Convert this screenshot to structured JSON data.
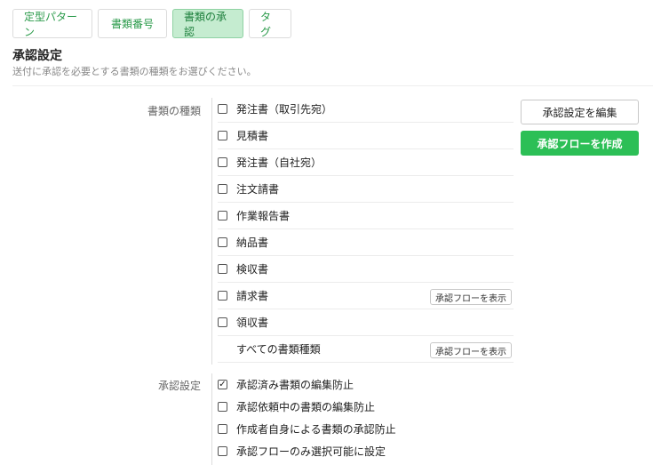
{
  "tabs": [
    {
      "label": "定型パターン",
      "active": false
    },
    {
      "label": "書類番号",
      "active": false
    },
    {
      "label": "書類の承認",
      "active": true
    },
    {
      "label": "タグ",
      "active": false
    }
  ],
  "section": {
    "title": "承認設定",
    "description": "送付に承認を必要とする書類の種類をお選びください。"
  },
  "doc_types": {
    "label": "書類の種類",
    "items": [
      {
        "label": "発注書（取引先宛）",
        "checked": false,
        "has_checkbox": true,
        "flow_button": ""
      },
      {
        "label": "見積書",
        "checked": false,
        "has_checkbox": true,
        "flow_button": ""
      },
      {
        "label": "発注書（自社宛）",
        "checked": false,
        "has_checkbox": true,
        "flow_button": ""
      },
      {
        "label": "注文請書",
        "checked": false,
        "has_checkbox": true,
        "flow_button": ""
      },
      {
        "label": "作業報告書",
        "checked": false,
        "has_checkbox": true,
        "flow_button": ""
      },
      {
        "label": "納品書",
        "checked": false,
        "has_checkbox": true,
        "flow_button": ""
      },
      {
        "label": "検収書",
        "checked": false,
        "has_checkbox": true,
        "flow_button": ""
      },
      {
        "label": "請求書",
        "checked": false,
        "has_checkbox": true,
        "flow_button": "承認フローを表示"
      },
      {
        "label": "領収書",
        "checked": false,
        "has_checkbox": true,
        "flow_button": ""
      },
      {
        "label": "すべての書類種類",
        "checked": false,
        "has_checkbox": false,
        "flow_button": "承認フローを表示"
      }
    ]
  },
  "buttons": {
    "edit": "承認設定を編集",
    "create": "承認フローを作成"
  },
  "approval_settings": {
    "label": "承認設定",
    "items": [
      {
        "label": "承認済み書類の編集防止",
        "checked": true
      },
      {
        "label": "承認依頼中の書類の編集防止",
        "checked": false
      },
      {
        "label": "作成者自身による書類の承認防止",
        "checked": false
      },
      {
        "label": "承認フローのみ選択可能に設定",
        "checked": false
      }
    ]
  },
  "colors": {
    "accent": "#2cbf56",
    "tab_active_bg": "#c5ecd0",
    "tab_text": "#2a9a4a"
  }
}
